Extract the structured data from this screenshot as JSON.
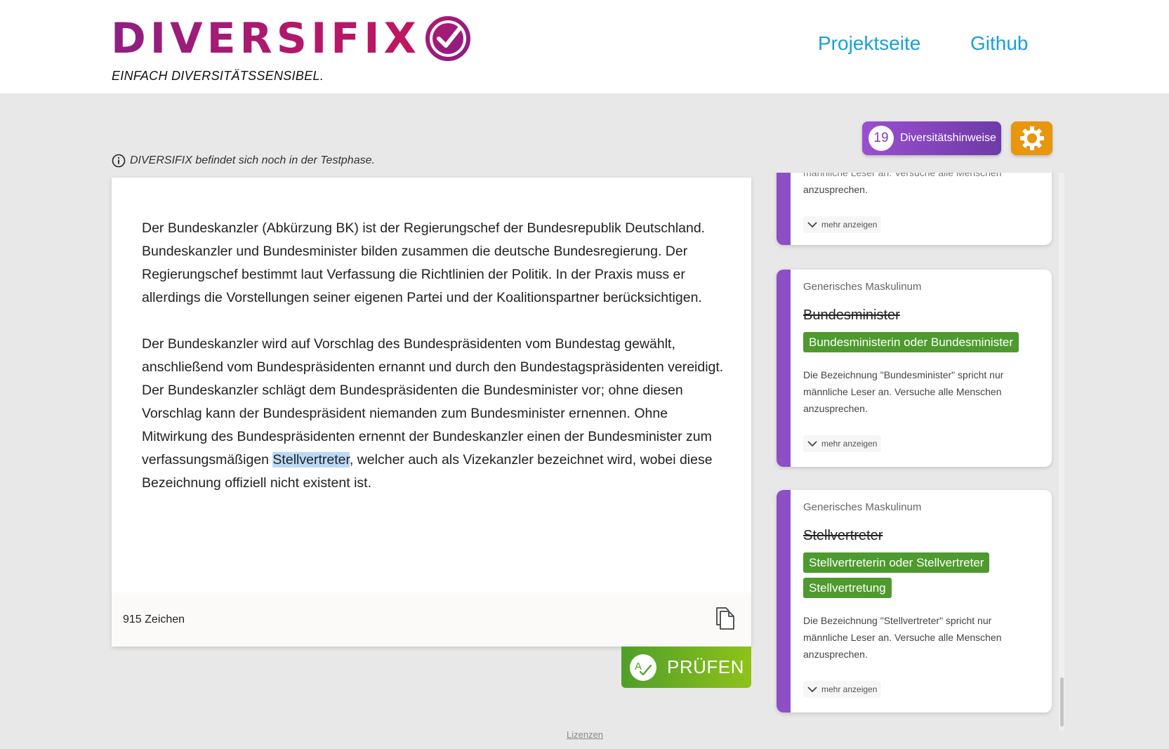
{
  "header": {
    "logo_text": "DIVERSIFIX",
    "tagline": "EINFACH DIVERSITÄTSSENSIBEL.",
    "nav": {
      "project_page": "Projektseite",
      "github": "Github"
    }
  },
  "toolbar": {
    "hints_count": "19",
    "hints_label": "Diversitätshinweise",
    "settings_icon": "gear-icon"
  },
  "info": {
    "icon": "info-icon",
    "text": "DIVERSIFIX befindet sich noch in der Testphase."
  },
  "editor": {
    "paragraph1": "Der Bundeskanzler (Abkürzung BK) ist der Regierungschef der Bundesrepublik Deutschland. Bundeskanzler und Bundesminister bilden zusammen die deutsche Bundesregierung. Der Regierungschef bestimmt laut Verfassung die Richtlinien der Politik. In der Praxis muss er allerdings die Vorstellungen seiner eigenen Partei und der Koalitionspartner berücksichtigen.",
    "paragraph2_before": "Der Bundeskanzler wird auf Vorschlag des Bundespräsidenten vom Bundestag gewählt, anschließend vom Bundespräsidenten ernannt und durch den Bundestagspräsidenten vereidigt. Der Bundeskanzler schlägt dem Bundespräsidenten die Bundesminister vor; ohne diesen Vorschlag kann der Bundespräsident niemanden zum Bundesminister ernennen. Ohne Mitwirkung des Bundespräsidenten ernennt der Bundeskanzler einen der Bundesminister zum verfassungsmäßigen ",
    "paragraph2_highlight": "Stellvertreter",
    "paragraph2_after": ", welcher auch als Vizekanzler bezeichnet wird, wobei diese Bezeichnung offiziell nicht existent ist.",
    "char_count": "915 Zeichen",
    "copy_icon": "copy-icon"
  },
  "check_button": {
    "label": "PRÜFEN",
    "icon": "spellcheck-icon"
  },
  "hints": [
    {
      "category": "",
      "word": "",
      "suggestions": [],
      "description_partial_line": "männliche Leser an. Versuche alle Menschen",
      "description": "anzusprechen.",
      "more_label": "mehr anzeigen"
    },
    {
      "category": "Generisches Maskulinum",
      "word": "Bundesminister",
      "suggestions": [
        "Bundesministerin oder Bundesminister"
      ],
      "description": "Die Bezeichnung \"Bundesminister\" spricht nur männliche Leser an. Versuche alle Menschen anzusprechen.",
      "more_label": "mehr anzeigen"
    },
    {
      "category": "Generisches Maskulinum",
      "word": "Stellvertreter",
      "suggestions": [
        "Stellvertreterin oder Stellvertreter",
        "Stellvertretung"
      ],
      "description": "Die Bezeichnung \"Stellvertreter\" spricht nur männliche Leser an. Versuche alle Menschen anzusprechen.",
      "more_label": "mehr anzeigen"
    }
  ],
  "footer": {
    "licenses": "Lizenzen"
  },
  "colors": {
    "brand_gradient_start": "#8e1f83",
    "brand_gradient_end": "#c01560",
    "nav_link": "#1a9fd6",
    "hints_button": "#7b41b8",
    "settings_button": "#e8960e",
    "suggestion_green": "#4e9a2e",
    "card_accent": "#8e4fc6",
    "highlight": "#bcd9f7"
  }
}
